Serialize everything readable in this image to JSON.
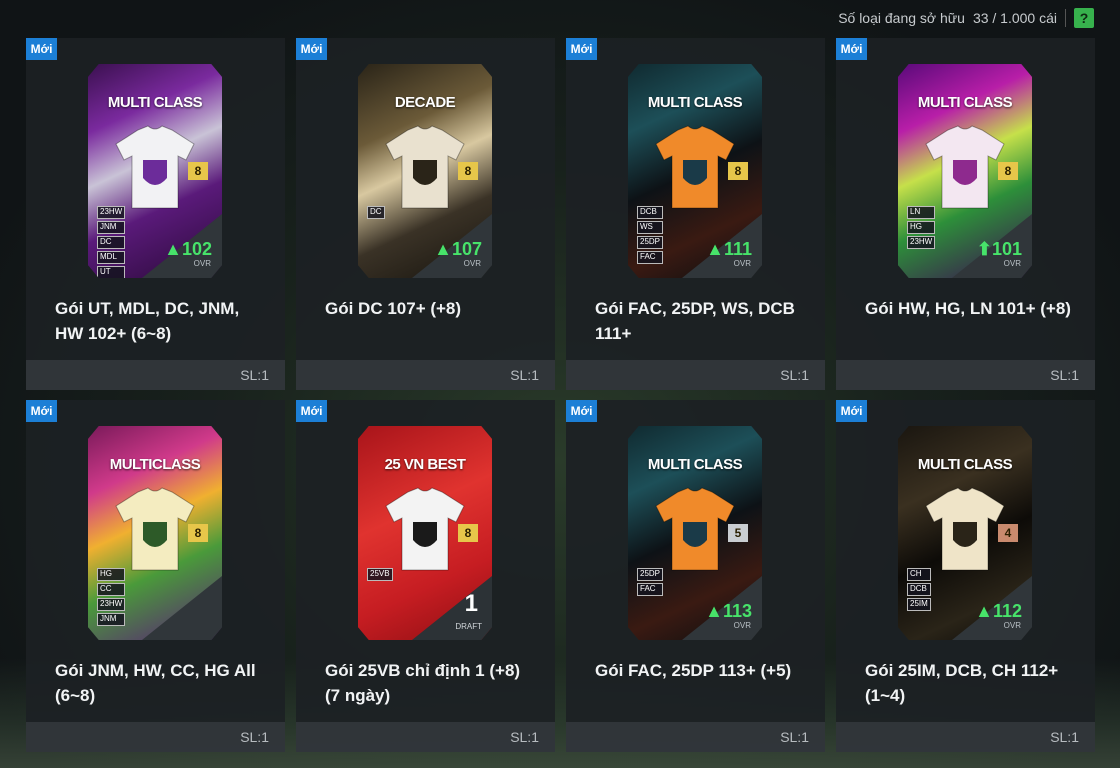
{
  "header": {
    "owned_label": "Số loại đang sở hữu",
    "owned_count": "33 / 1.000 cái",
    "help_label": "?"
  },
  "colors": {
    "new_badge": "#1c7fd6",
    "ovr_green": "#47e36a",
    "help_green": "#37b24d"
  },
  "packs": [
    {
      "badge": "Mới",
      "card_title": "MULTI CLASS",
      "level": "8",
      "level_color": "#e7c64a",
      "tags": [
        "23HW",
        "JNM",
        "DC",
        "MDL",
        "UT"
      ],
      "ovr": "▲102",
      "ovr_label": "OVR",
      "theme": "purple",
      "name": "Gói UT, MDL, DC, JNM, HW 102+ (6~8)",
      "qty": "SL:1"
    },
    {
      "badge": "Mới",
      "card_title": "DECADE",
      "level": "8",
      "level_color": "#e7c64a",
      "tags": [
        "DC"
      ],
      "ovr": "▲107",
      "ovr_label": "OVR",
      "theme": "gold",
      "name": "Gói DC 107+ (+8)",
      "qty": "SL:1"
    },
    {
      "badge": "Mới",
      "card_title": "MULTI CLASS",
      "level": "8",
      "level_color": "#e7c64a",
      "tags": [
        "DCB",
        "WS",
        "25DP",
        "FAC"
      ],
      "ovr": "▲111",
      "ovr_label": "OVR",
      "theme": "dark",
      "name": "Gói FAC, 25DP, WS, DCB 111+",
      "qty": "SL:1"
    },
    {
      "badge": "Mới",
      "card_title": "MULTI CLASS",
      "level": "8",
      "level_color": "#e7c64a",
      "tags": [
        "LN",
        "HG",
        "23HW"
      ],
      "ovr": "⬆101",
      "ovr_label": "OVR",
      "theme": "neon",
      "name": "Gói HW, HG, LN 101+ (+8)",
      "qty": "SL:1"
    },
    {
      "badge": "Mới",
      "card_title": "MULTICLASS",
      "level": "8",
      "level_color": "#e7c64a",
      "tags": [
        "HG",
        "CC",
        "23HW",
        "JNM"
      ],
      "ovr": "",
      "ovr_label": "",
      "theme": "rainbow",
      "name": "Gói JNM, HW, CC, HG All (6~8)",
      "qty": "SL:1"
    },
    {
      "badge": "Mới",
      "card_title": "25 VN BEST",
      "level": "8",
      "level_color": "#e7c64a",
      "tags": [
        "25VB"
      ],
      "draft_num": "1",
      "draft_label": "DRAFT",
      "theme": "red",
      "name": "Gói 25VB chỉ định 1 (+8) (7 ngày)",
      "qty": "SL:1"
    },
    {
      "badge": "Mới",
      "card_title": "MULTI CLASS",
      "level": "5",
      "level_color": "#c9cdd1",
      "tags": [
        "25DP",
        "FAC"
      ],
      "ovr": "▲113",
      "ovr_label": "OVR",
      "theme": "dark",
      "name": "Gói FAC, 25DP 113+ (+5)",
      "qty": "SL:1"
    },
    {
      "badge": "Mới",
      "card_title": "MULTI CLASS",
      "level": "4",
      "level_color": "#c98a6e",
      "tags": [
        "CH",
        "DCB",
        "25IM"
      ],
      "ovr": "▲112",
      "ovr_label": "OVR",
      "theme": "black",
      "name": "Gói 25IM, DCB, CH 112+ (1~4)",
      "qty": "SL:1"
    }
  ]
}
